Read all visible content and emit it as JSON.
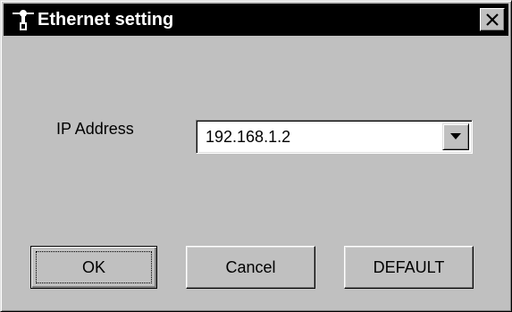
{
  "window": {
    "title": "Ethernet setting",
    "title_icon": "network-plug-icon",
    "close_icon": "close-icon"
  },
  "form": {
    "ip_label": "IP Address",
    "ip_value": "192.168.1.2",
    "dropdown_icon": "chevron-down-icon"
  },
  "buttons": {
    "ok": "OK",
    "cancel": "Cancel",
    "default": "DEFAULT"
  },
  "colors": {
    "window_bg": "#c0c0c0",
    "titlebar_bg": "#000000",
    "title_text": "#ffffff",
    "field_bg": "#ffffff"
  }
}
